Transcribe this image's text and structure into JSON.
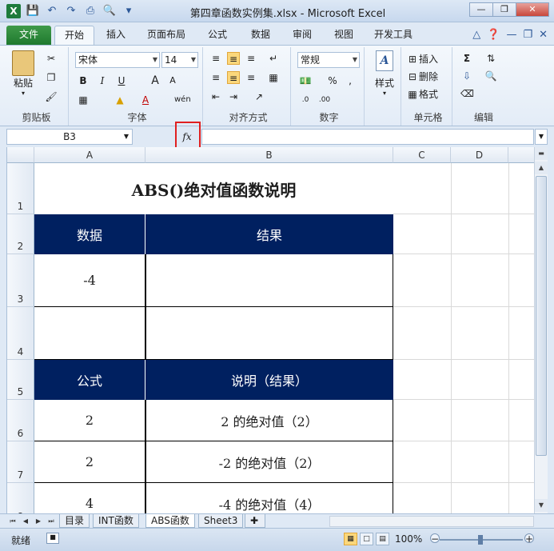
{
  "window": {
    "title": "第四章函数实例集.xlsx - Microsoft Excel",
    "app_icon": "X"
  },
  "tabs": [
    {
      "label": "文件"
    },
    {
      "label": "开始"
    },
    {
      "label": "插入"
    },
    {
      "label": "页面布局"
    },
    {
      "label": "公式"
    },
    {
      "label": "数据"
    },
    {
      "label": "审阅"
    },
    {
      "label": "视图"
    },
    {
      "label": "开发工具"
    }
  ],
  "ribbon": {
    "clipboard": {
      "label": "剪贴板",
      "paste": "粘贴"
    },
    "font": {
      "label": "字体",
      "name": "宋体",
      "size": "14",
      "bold": "B",
      "italic": "I",
      "underline": "U",
      "grow": "A",
      "shrink": "A",
      "fontcolor": "A",
      "wen": "wén"
    },
    "alignment": {
      "label": "对齐方式"
    },
    "number": {
      "label": "数字",
      "format": "常规",
      "percent": "%",
      "comma": ","
    },
    "styles": {
      "label": "样式"
    },
    "cells": {
      "label": "单元格",
      "insert": "插入",
      "delete": "删除",
      "format": "格式"
    },
    "editing": {
      "label": "编辑",
      "sum": "Σ"
    }
  },
  "formula_bar": {
    "name_box": "B3",
    "fx": "fx",
    "formula": ""
  },
  "columns": [
    "A",
    "B",
    "C",
    "D"
  ],
  "rows": [
    "1",
    "2",
    "3",
    "4",
    "5",
    "6",
    "7",
    "8"
  ],
  "sheet": {
    "title": "ABS()绝对值函数说明",
    "header1": {
      "a": "数据",
      "b": "结果"
    },
    "r3": {
      "a": "-4",
      "b": ""
    },
    "r4": {
      "a": "",
      "b": ""
    },
    "header2": {
      "a": "公式",
      "b": "说明（结果）"
    },
    "r6": {
      "a": "2",
      "b": "2 的绝对值（2）"
    },
    "r7": {
      "a": "2",
      "b": "-2 的绝对值（2）"
    },
    "r8": {
      "a": "4",
      "b": "-4 的绝对值（4）"
    }
  },
  "sheet_tabs": [
    "目录",
    "INT函数",
    "ABS函数",
    "Sheet3"
  ],
  "status": {
    "ready": "就绪",
    "zoom": "100%"
  },
  "colors": {
    "header_fill": "#002060",
    "highlight": "#e02020",
    "file_tab": "#1f7a2e"
  }
}
